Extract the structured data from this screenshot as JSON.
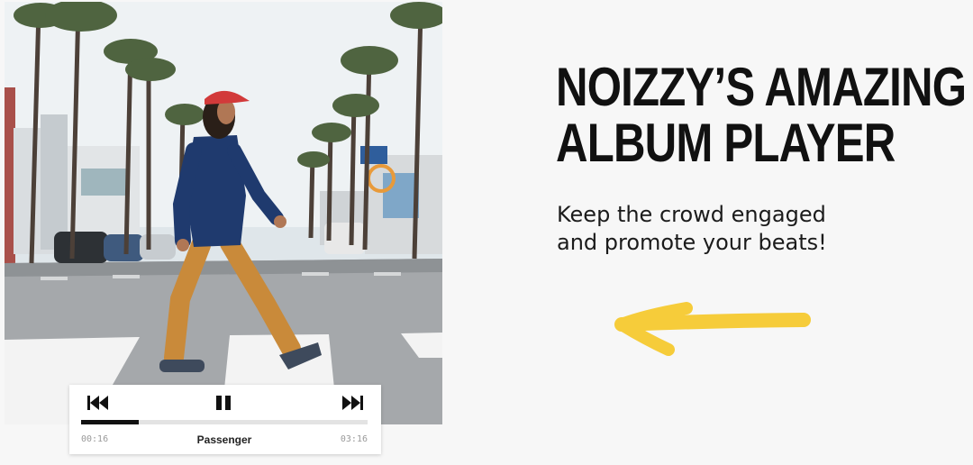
{
  "headline": {
    "line1": "NOIZZY’S AMAZING",
    "line2": "ALBUM PLAYER"
  },
  "subtitle": {
    "line1": "Keep the crowd engaged",
    "line2": "and promote your beats!"
  },
  "player": {
    "track_title": "Passenger",
    "elapsed": "00:16",
    "duration": "03:16",
    "progress": 0.2,
    "icons": {
      "prev": "skip-previous-icon",
      "pause": "pause-icon",
      "next": "skip-next-icon"
    }
  },
  "colors": {
    "accent_arrow": "#f6cc3a",
    "text": "#111111",
    "background": "#f7f7f7"
  }
}
